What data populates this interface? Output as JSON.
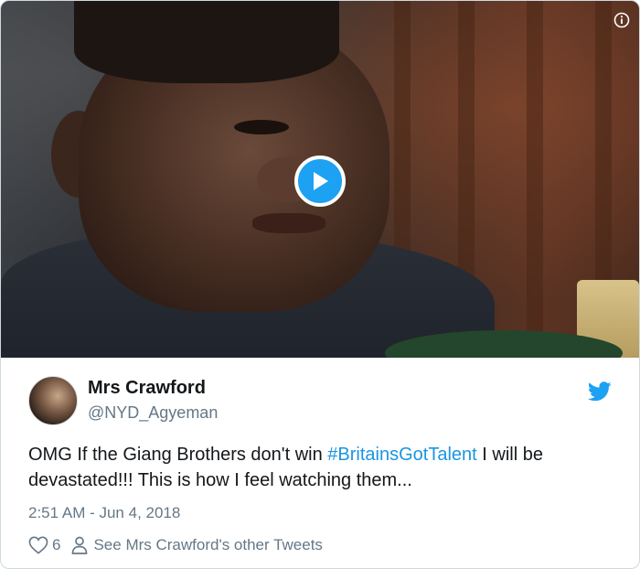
{
  "tweet": {
    "author_name": "Mrs Crawford",
    "author_handle": "@NYD_Agyeman",
    "text_before": "OMG If the Giang Brothers don't win ",
    "hashtag": "#BritainsGotTalent",
    "text_after": " I will be devastated!!! This is how I feel watching them...",
    "timestamp": "2:51 AM - Jun 4, 2018",
    "like_count": "6",
    "other_tweets_label": "See Mrs Crawford's other Tweets"
  },
  "media": {
    "type": "video",
    "play_icon": "play-icon",
    "info_icon": "info-icon"
  },
  "colors": {
    "accent": "#1da1f2",
    "hashtag": "#1b95e0",
    "secondary_text": "#657786",
    "primary_text": "#14171a"
  }
}
